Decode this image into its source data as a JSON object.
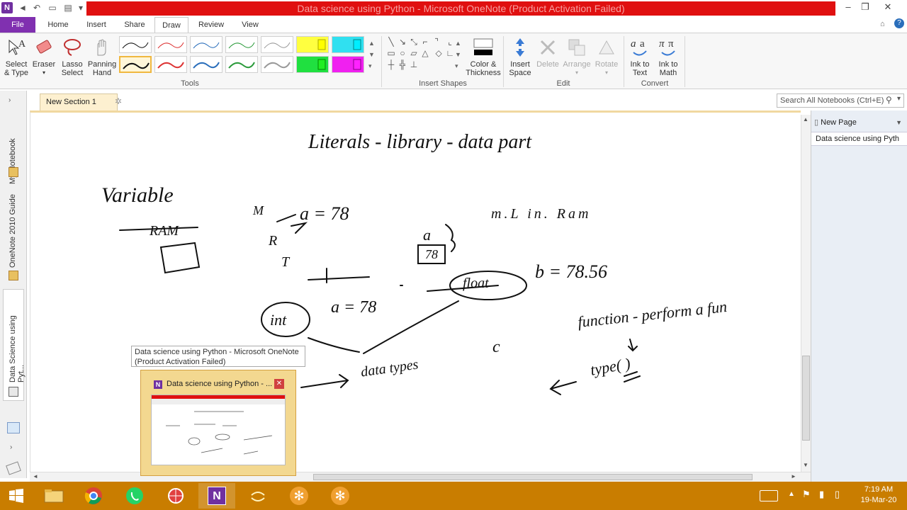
{
  "window": {
    "title": "Data science using Python - Microsoft OneNote (Product Activation Failed)"
  },
  "ribbon_tabs": [
    "File",
    "Home",
    "Insert",
    "Share",
    "Draw",
    "Review",
    "View"
  ],
  "active_tab": "Draw",
  "ribbon": {
    "tools": {
      "select_type": "Select & Type",
      "select_type_l1": "Select",
      "select_type_l2": "& Type",
      "eraser": "Eraser",
      "lasso_l1": "Lasso",
      "lasso_l2": "Select",
      "panning_l1": "Panning",
      "panning_l2": "Hand",
      "group_label": "Tools"
    },
    "shapes": {
      "color_l1": "Color &",
      "color_l2": "Thickness",
      "group_label": "Insert Shapes"
    },
    "edit": {
      "insert_space_l1": "Insert",
      "insert_space_l2": "Space",
      "delete": "Delete",
      "arrange": "Arrange",
      "rotate": "Rotate",
      "group_label": "Edit"
    },
    "convert": {
      "ink_text_l1": "Ink to",
      "ink_text_l2": "Text",
      "ink_math_l1": "Ink to",
      "ink_math_l2": "Math",
      "group_label": "Convert"
    }
  },
  "section": {
    "tab_label": "New Section 1"
  },
  "search": {
    "placeholder": "Search All Notebooks (Ctrl+E)"
  },
  "left_pane": {
    "notebooks": [
      "My Notebook",
      "OneNote 2010 Guide",
      "Data Science using Pyt..."
    ]
  },
  "right_pane": {
    "new_page": "New Page",
    "pages": [
      "Data science using Pyth"
    ]
  },
  "tooltip": {
    "line1": "Data science using Python - Microsoft OneNote",
    "line2": "(Product Activation Failed)"
  },
  "thumbnail": {
    "title": "Data science using Python - ..."
  },
  "ink_notes": {
    "heading": "Literals - library - data part",
    "variable": "Variable",
    "ram": "RAM",
    "a_equals": "a = 78",
    "ml_in_ram": "m.L in. Ram",
    "a_box_label": "a",
    "box_value": "78",
    "float_label": "float",
    "b_equals": "b = 78.56",
    "int_label": "int",
    "a_equals_2": "a = 78",
    "function": "function - perform a fun",
    "c_label": "c",
    "data_types": "data types",
    "type_call": "type( )",
    "m": "M",
    "r": "R",
    "t": "T"
  },
  "taskbar": {
    "time": "7:19 AM",
    "date": "19-Mar-20"
  },
  "colors": {
    "file_tab": "#8030b0",
    "title_red": "#e01010",
    "taskbar": "#c97d00",
    "section_tab": "#fdf0d0"
  }
}
